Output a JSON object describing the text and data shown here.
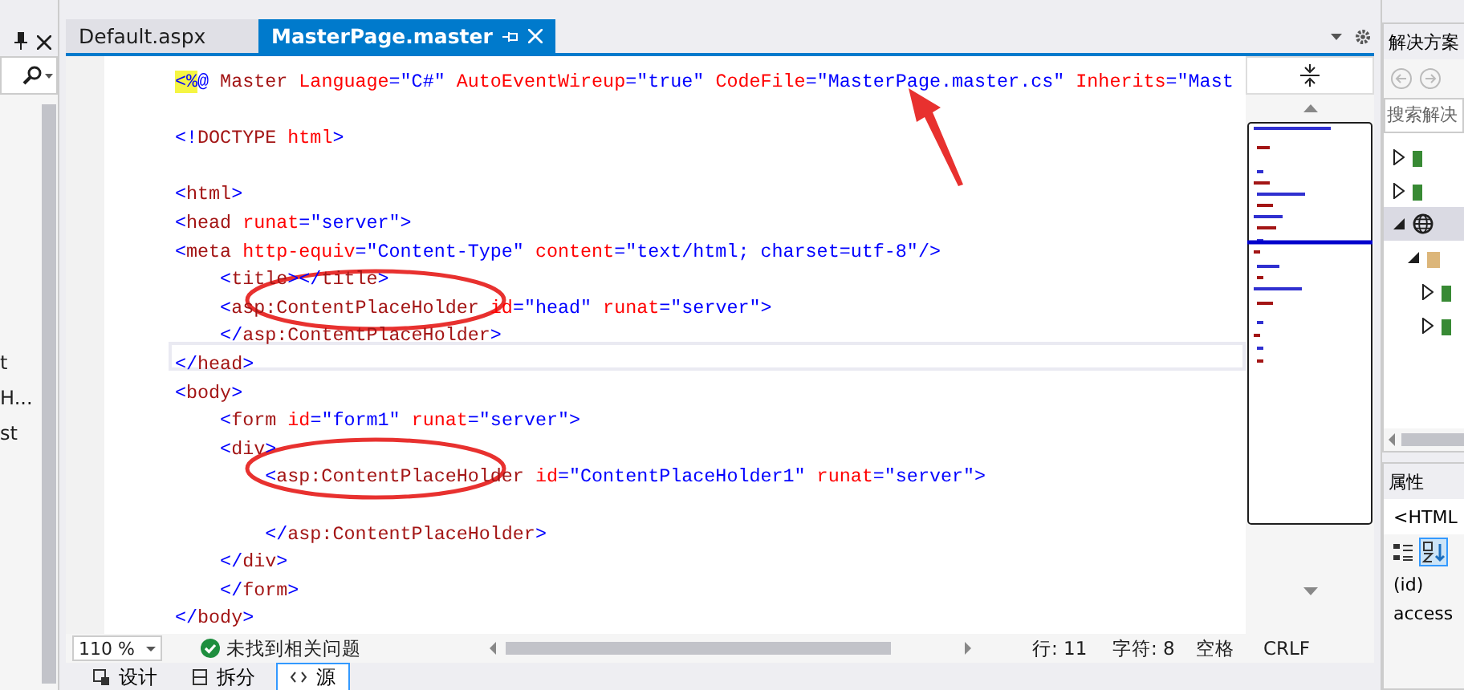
{
  "left_panel": {
    "items": [
      {
        "label": "t"
      },
      {
        "label": "H..."
      },
      {
        "label": "st"
      }
    ]
  },
  "tabs": [
    {
      "label": "Default.aspx",
      "selected": false
    },
    {
      "label": "MasterPage.master",
      "selected": true
    }
  ],
  "code_lines": [
    {
      "kind": "code",
      "current": false,
      "circled": false,
      "pointed": true,
      "tokens": [
        {
          "kind": "highlight",
          "text": "<%"
        },
        {
          "kind": "delimiter",
          "text": "@"
        },
        {
          "kind": "element",
          "text": " Master"
        },
        {
          "kind": "attribute",
          "text": " Language"
        },
        {
          "kind": "delimiter",
          "text": "="
        },
        {
          "kind": "value",
          "text": "\"C#\""
        },
        {
          "kind": "attribute",
          "text": " AutoEventWireup"
        },
        {
          "kind": "delimiter",
          "text": "="
        },
        {
          "kind": "value",
          "text": "\"true\""
        },
        {
          "kind": "attribute",
          "text": " CodeFile"
        },
        {
          "kind": "delimiter",
          "text": "="
        },
        {
          "kind": "value",
          "text": "\"MasterPage.master.cs\""
        },
        {
          "kind": "attribute",
          "text": " Inherits"
        },
        {
          "kind": "delimiter",
          "text": "="
        },
        {
          "kind": "value",
          "text": "\"Mast"
        }
      ]
    },
    {
      "kind": "blank"
    },
    {
      "kind": "code",
      "current": false,
      "tokens": [
        {
          "kind": "delimiter",
          "text": "<!"
        },
        {
          "kind": "element",
          "text": "DOCTYPE"
        },
        {
          "kind": "attribute",
          "text": " html"
        },
        {
          "kind": "delimiter",
          "text": ">"
        }
      ]
    },
    {
      "kind": "blank"
    },
    {
      "kind": "code",
      "current": false,
      "tokens": [
        {
          "kind": "delimiter",
          "text": "<"
        },
        {
          "kind": "element",
          "text": "html"
        },
        {
          "kind": "delimiter",
          "text": ">"
        }
      ]
    },
    {
      "kind": "code",
      "current": false,
      "tokens": [
        {
          "kind": "delimiter",
          "text": "<"
        },
        {
          "kind": "element",
          "text": "head"
        },
        {
          "kind": "attribute",
          "text": " runat"
        },
        {
          "kind": "delimiter",
          "text": "="
        },
        {
          "kind": "value",
          "text": "\"server\""
        },
        {
          "kind": "delimiter",
          "text": ">"
        }
      ]
    },
    {
      "kind": "code",
      "current": false,
      "tokens": [
        {
          "kind": "delimiter",
          "text": "<"
        },
        {
          "kind": "element",
          "text": "meta"
        },
        {
          "kind": "attribute",
          "text": " http-equiv"
        },
        {
          "kind": "delimiter",
          "text": "="
        },
        {
          "kind": "value",
          "text": "\"Content-Type\""
        },
        {
          "kind": "attribute",
          "text": " content"
        },
        {
          "kind": "delimiter",
          "text": "="
        },
        {
          "kind": "value",
          "text": "\"text/html; charset=utf-8\""
        },
        {
          "kind": "delimiter",
          "text": "/>"
        }
      ]
    },
    {
      "kind": "code",
      "current": false,
      "tokens": [
        {
          "kind": "delimiter",
          "text": "    <"
        },
        {
          "kind": "element",
          "text": "title"
        },
        {
          "kind": "delimiter",
          "text": "></"
        },
        {
          "kind": "element",
          "text": "title"
        },
        {
          "kind": "delimiter",
          "text": ">"
        }
      ]
    },
    {
      "kind": "code",
      "current": false,
      "circled": true,
      "pointed": false,
      "tokens": [
        {
          "kind": "delimiter",
          "text": "    <"
        },
        {
          "kind": "element",
          "text": "asp:ContentPlaceHolder"
        },
        {
          "kind": "attribute",
          "text": " id"
        },
        {
          "kind": "delimiter",
          "text": "="
        },
        {
          "kind": "value",
          "text": "\"head\""
        },
        {
          "kind": "attribute",
          "text": " runat"
        },
        {
          "kind": "delimiter",
          "text": "="
        },
        {
          "kind": "value",
          "text": "\"server\""
        },
        {
          "kind": "delimiter",
          "text": ">"
        }
      ]
    },
    {
      "kind": "code",
      "current": false,
      "tokens": [
        {
          "kind": "delimiter",
          "text": "    </"
        },
        {
          "kind": "element",
          "text": "asp:ContentPlaceHolder"
        },
        {
          "kind": "delimiter",
          "text": ">"
        }
      ]
    },
    {
      "kind": "code",
      "current": true,
      "tokens": [
        {
          "kind": "delimiter",
          "text": "</"
        },
        {
          "kind": "element",
          "text": "head"
        },
        {
          "kind": "delimiter",
          "text": ">"
        }
      ]
    },
    {
      "kind": "code",
      "current": false,
      "tokens": [
        {
          "kind": "delimiter",
          "text": "<"
        },
        {
          "kind": "element",
          "text": "body"
        },
        {
          "kind": "delimiter",
          "text": ">"
        }
      ]
    },
    {
      "kind": "code",
      "current": false,
      "tokens": [
        {
          "kind": "delimiter",
          "text": "    <"
        },
        {
          "kind": "element",
          "text": "form"
        },
        {
          "kind": "attribute",
          "text": " id"
        },
        {
          "kind": "delimiter",
          "text": "="
        },
        {
          "kind": "value",
          "text": "\"form1\""
        },
        {
          "kind": "attribute",
          "text": " runat"
        },
        {
          "kind": "delimiter",
          "text": "="
        },
        {
          "kind": "value",
          "text": "\"server\""
        },
        {
          "kind": "delimiter",
          "text": ">"
        }
      ]
    },
    {
      "kind": "code",
      "current": false,
      "tokens": [
        {
          "kind": "delimiter",
          "text": "    <"
        },
        {
          "kind": "element",
          "text": "div"
        },
        {
          "kind": "delimiter",
          "text": ">"
        }
      ]
    },
    {
      "kind": "code",
      "current": false,
      "circled": true,
      "pointed": false,
      "tokens": [
        {
          "kind": "delimiter",
          "text": "        <"
        },
        {
          "kind": "element",
          "text": "asp:ContentPlaceHolder"
        },
        {
          "kind": "attribute",
          "text": " id"
        },
        {
          "kind": "delimiter",
          "text": "="
        },
        {
          "kind": "value",
          "text": "\"ContentPlaceHolder1\""
        },
        {
          "kind": "attribute",
          "text": " runat"
        },
        {
          "kind": "delimiter",
          "text": "="
        },
        {
          "kind": "value",
          "text": "\"server\""
        },
        {
          "kind": "delimiter",
          "text": ">"
        }
      ]
    },
    {
      "kind": "blank"
    },
    {
      "kind": "code",
      "current": false,
      "tokens": [
        {
          "kind": "delimiter",
          "text": "        </"
        },
        {
          "kind": "element",
          "text": "asp:ContentPlaceHolder"
        },
        {
          "kind": "delimiter",
          "text": ">"
        }
      ]
    },
    {
      "kind": "code",
      "current": false,
      "tokens": [
        {
          "kind": "delimiter",
          "text": "    </"
        },
        {
          "kind": "element",
          "text": "div"
        },
        {
          "kind": "delimiter",
          "text": ">"
        }
      ]
    },
    {
      "kind": "code",
      "current": false,
      "tokens": [
        {
          "kind": "delimiter",
          "text": "    </"
        },
        {
          "kind": "element",
          "text": "form"
        },
        {
          "kind": "delimiter",
          "text": ">"
        }
      ]
    },
    {
      "kind": "code",
      "current": false,
      "tokens": [
        {
          "kind": "delimiter",
          "text": "</"
        },
        {
          "kind": "element",
          "text": "body"
        },
        {
          "kind": "delimiter",
          "text": ">"
        }
      ]
    }
  ],
  "status_bar": {
    "zoom": "110 %",
    "issues": "未找到相关问题",
    "line": "行: 11",
    "column": "字符: 8",
    "indent": "空格",
    "line_ending": "CRLF"
  },
  "view_tabs": [
    {
      "label": "设计",
      "kind": "design",
      "selected": false
    },
    {
      "label": "拆分",
      "kind": "split",
      "selected": false
    },
    {
      "label": "源",
      "kind": "source",
      "selected": true
    }
  ],
  "solution_explorer": {
    "title": "解决方案",
    "search": {
      "placeholder": "搜索解决"
    },
    "tree": [
      {
        "kind": "file",
        "expanded": false,
        "selected": false
      },
      {
        "kind": "file",
        "expanded": false,
        "selected": false
      },
      {
        "kind": "website",
        "expanded": true,
        "selected": true,
        "children": [
          {
            "kind": "folder",
            "expanded": true,
            "selected": false,
            "children": [
              {
                "kind": "file",
                "expanded": false,
                "selected": false
              },
              {
                "kind": "file",
                "expanded": false,
                "selected": false
              }
            ]
          }
        ]
      }
    ]
  },
  "properties": {
    "title": "属性",
    "object": "<HTML",
    "rows": [
      {
        "label": "(id)"
      },
      {
        "label": "access"
      }
    ]
  }
}
